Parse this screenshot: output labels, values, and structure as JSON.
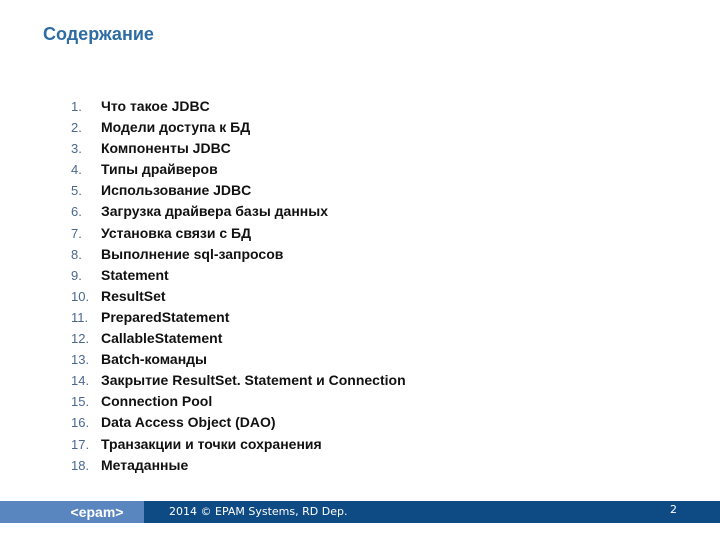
{
  "title": "Содержание",
  "items": [
    {
      "n": "1.",
      "t": "Что такое JDBC"
    },
    {
      "n": "2.",
      "t": "Модели доступа к БД"
    },
    {
      "n": "3.",
      "t": "Компоненты JDBC"
    },
    {
      "n": "4.",
      "t": "Типы драйверов"
    },
    {
      "n": "5.",
      "t": "Использование JDBC"
    },
    {
      "n": "6.",
      "t": "Загрузка драйвера базы данных"
    },
    {
      "n": "7.",
      "t": "Установка связи с БД"
    },
    {
      "n": "8.",
      "t": "Выполнение sql-запросов"
    },
    {
      "n": "9.",
      "t": "Statement"
    },
    {
      "n": "10.",
      "t": "ResultSet"
    },
    {
      "n": "11.",
      "t": "PreparedStatement"
    },
    {
      "n": "12.",
      "t": "CallableStatement"
    },
    {
      "n": "13.",
      "t": "Batch-команды"
    },
    {
      "n": "14.",
      "t": "Закрытие ResultSet. Statement и Connection"
    },
    {
      "n": "15.",
      "t": "Connection Pool"
    },
    {
      "n": "16.",
      "t": "Data Access Object (DAO)"
    },
    {
      "n": "17.",
      "t": "Транзакции и точки сохранения"
    },
    {
      "n": "18.",
      "t": "Метаданные"
    }
  ],
  "footer": {
    "logo": "<epam>",
    "copyright": "2014 © EPAM Systems, RD Dep.",
    "page": "2"
  },
  "colors": {
    "title": "#2e6da4",
    "footer_bar": "#0e4a84",
    "logo_block": "#5a86c0"
  }
}
